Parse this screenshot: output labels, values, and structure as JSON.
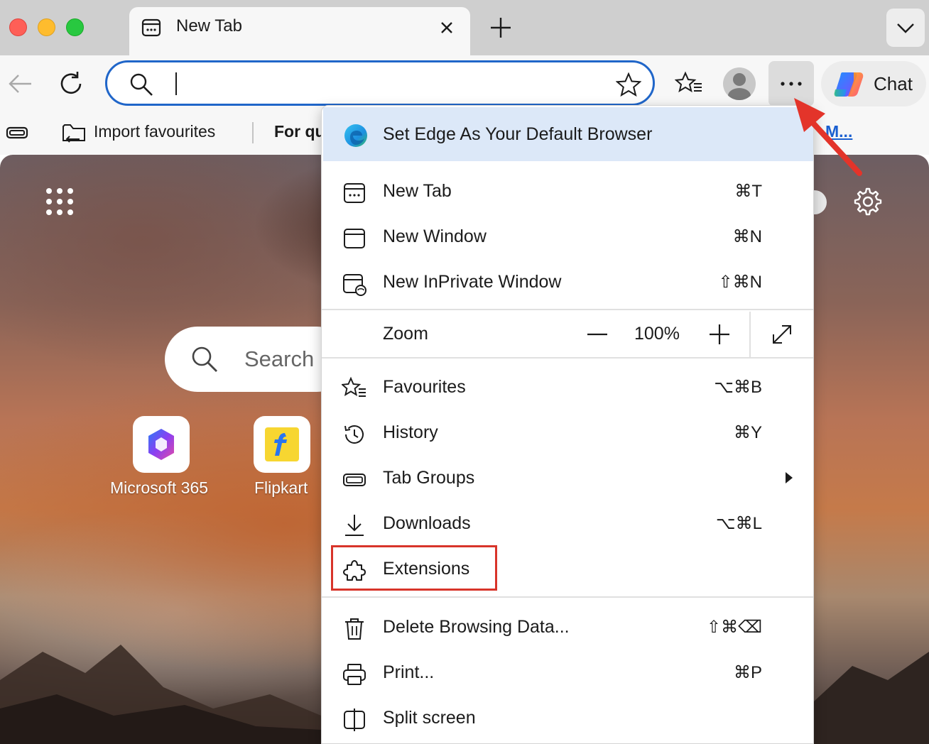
{
  "window": {
    "tab": {
      "title": "New Tab",
      "icon": "new-tab-page-icon"
    }
  },
  "toolbar": {
    "address": {
      "value": "",
      "placeholder": ""
    },
    "chat_label": "Chat"
  },
  "favorites_bar": {
    "import_label": "Import favourites",
    "partial_label": "For qu",
    "overflow_link": "M..."
  },
  "new_tab_page": {
    "search_placeholder": "Search",
    "tiles": [
      {
        "label": "Microsoft 365",
        "icon": "microsoft-365-icon"
      },
      {
        "label": "Flipkart",
        "icon": "flipkart-icon"
      }
    ]
  },
  "menu": {
    "banner": "Set Edge As Your Default Browser",
    "items": [
      {
        "label": "New Tab",
        "shortcut": "⌘T",
        "icon": "new-tab-icon"
      },
      {
        "label": "New Window",
        "shortcut": "⌘N",
        "icon": "new-window-icon"
      },
      {
        "label": "New InPrivate Window",
        "shortcut": "⇧⌘N",
        "icon": "inprivate-icon"
      },
      {
        "label": "Favourites",
        "shortcut": "⌥⌘B",
        "icon": "favourites-icon"
      },
      {
        "label": "History",
        "shortcut": "⌘Y",
        "icon": "history-icon"
      },
      {
        "label": "Tab Groups",
        "shortcut": "",
        "icon": "tab-groups-icon",
        "submenu": true
      },
      {
        "label": "Downloads",
        "shortcut": "⌥⌘L",
        "icon": "downloads-icon"
      },
      {
        "label": "Extensions",
        "shortcut": "",
        "icon": "extensions-icon",
        "highlighted": true
      },
      {
        "label": "Delete Browsing Data...",
        "shortcut": "⇧⌘⌫",
        "icon": "trash-icon"
      },
      {
        "label": "Print...",
        "shortcut": "⌘P",
        "icon": "print-icon"
      },
      {
        "label": "Split screen",
        "shortcut": "",
        "icon": "split-screen-icon"
      }
    ],
    "zoom": {
      "label": "Zoom",
      "value": "100%"
    }
  },
  "colors": {
    "accent": "#2066c9",
    "highlight": "#d8342a",
    "banner_bg": "#dce8f8"
  }
}
